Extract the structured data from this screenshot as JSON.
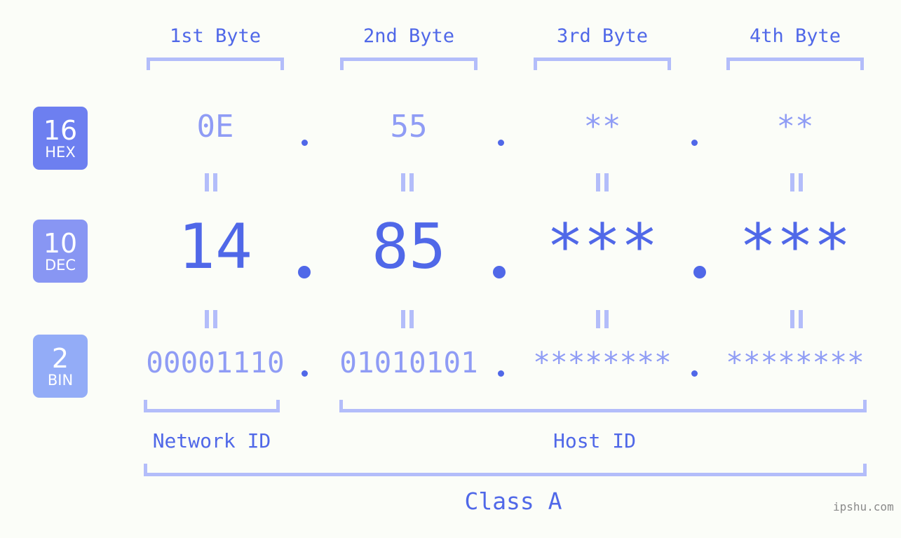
{
  "watermark": "ipshu.com",
  "colors": {
    "background": "#fbfdf8",
    "accent_strong": "#5068e8",
    "accent_light": "#8f9cf5",
    "bracket": "#b3bdfa",
    "badge_hex": "#6d7ff0",
    "badge_dec": "#8896f3",
    "badge_bin": "#93acf7",
    "watermark": "#8a8a8a"
  },
  "byte_headers": [
    {
      "label": "1st Byte"
    },
    {
      "label": "2nd Byte"
    },
    {
      "label": "3rd Byte"
    },
    {
      "label": "4th Byte"
    }
  ],
  "bases": [
    {
      "number": "16",
      "name": "HEX"
    },
    {
      "number": "10",
      "name": "DEC"
    },
    {
      "number": "2",
      "name": "BIN"
    }
  ],
  "rows": {
    "hex": {
      "base": "16",
      "name": "HEX",
      "values": [
        "0E",
        "55",
        "**",
        "**"
      ],
      "separator": "."
    },
    "dec": {
      "base": "10",
      "name": "DEC",
      "values": [
        "14",
        "85",
        "***",
        "***"
      ],
      "separator": "."
    },
    "bin": {
      "base": "2",
      "name": "BIN",
      "values": [
        "00001110",
        "01010101",
        "********",
        "********"
      ],
      "separator": "."
    }
  },
  "equals_glyph": "=",
  "segments": {
    "network_id": "Network ID",
    "host_id": "Host ID",
    "class": "Class A"
  }
}
